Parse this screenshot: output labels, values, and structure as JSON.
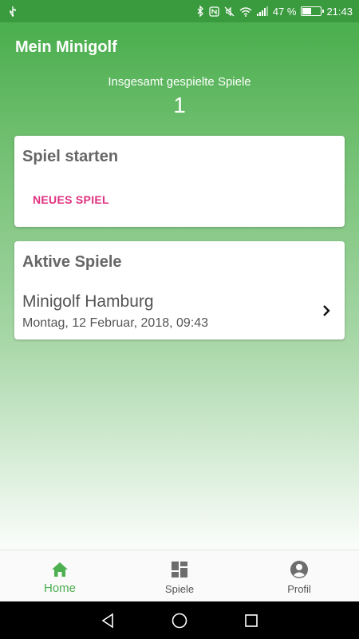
{
  "status_bar": {
    "battery_percent": "47 %",
    "time": "21:43",
    "battery_level": 0.47,
    "icons": [
      "usb-icon",
      "bluetooth-icon",
      "nfc-icon",
      "mute-icon",
      "wifi-icon",
      "signal-icon",
      "battery-icon"
    ]
  },
  "header": {
    "title": "Mein Minigolf",
    "stats_label": "Insgesamt gespielte Spiele",
    "stats_value": "1"
  },
  "start_card": {
    "title": "Spiel starten",
    "new_game_label": "NEUES SPIEL"
  },
  "active_card": {
    "title": "Aktive Spiele",
    "games": [
      {
        "name": "Minigolf Hamburg",
        "date": "Montag, 12 Februar, 2018, 09:43"
      }
    ]
  },
  "bottom_nav": {
    "items": [
      {
        "label": "Home",
        "icon": "home-icon",
        "active": true
      },
      {
        "label": "Spiele",
        "icon": "dashboard-icon",
        "active": false
      },
      {
        "label": "Profil",
        "icon": "account-circle-icon",
        "active": false
      }
    ]
  },
  "colors": {
    "primary": "#4caf50",
    "status_bar": "#3a9a3e",
    "accent": "#e0307f",
    "card_title": "#666666"
  }
}
